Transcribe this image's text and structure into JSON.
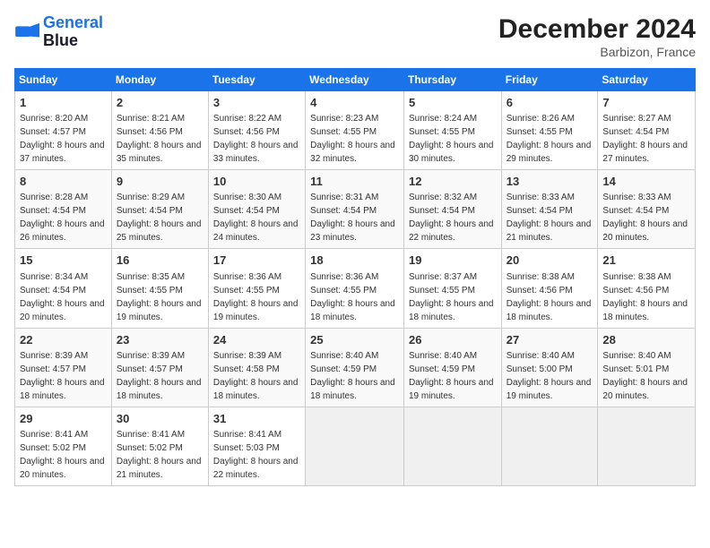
{
  "logo": {
    "line1": "General",
    "line2": "Blue"
  },
  "title": "December 2024",
  "location": "Barbizon, France",
  "days_of_week": [
    "Sunday",
    "Monday",
    "Tuesday",
    "Wednesday",
    "Thursday",
    "Friday",
    "Saturday"
  ],
  "weeks": [
    [
      {
        "day": 1,
        "sunrise": "8:20 AM",
        "sunset": "4:57 PM",
        "daylight": "8 hours and 37 minutes."
      },
      {
        "day": 2,
        "sunrise": "8:21 AM",
        "sunset": "4:56 PM",
        "daylight": "8 hours and 35 minutes."
      },
      {
        "day": 3,
        "sunrise": "8:22 AM",
        "sunset": "4:56 PM",
        "daylight": "8 hours and 33 minutes."
      },
      {
        "day": 4,
        "sunrise": "8:23 AM",
        "sunset": "4:55 PM",
        "daylight": "8 hours and 32 minutes."
      },
      {
        "day": 5,
        "sunrise": "8:24 AM",
        "sunset": "4:55 PM",
        "daylight": "8 hours and 30 minutes."
      },
      {
        "day": 6,
        "sunrise": "8:26 AM",
        "sunset": "4:55 PM",
        "daylight": "8 hours and 29 minutes."
      },
      {
        "day": 7,
        "sunrise": "8:27 AM",
        "sunset": "4:54 PM",
        "daylight": "8 hours and 27 minutes."
      }
    ],
    [
      {
        "day": 8,
        "sunrise": "8:28 AM",
        "sunset": "4:54 PM",
        "daylight": "8 hours and 26 minutes."
      },
      {
        "day": 9,
        "sunrise": "8:29 AM",
        "sunset": "4:54 PM",
        "daylight": "8 hours and 25 minutes."
      },
      {
        "day": 10,
        "sunrise": "8:30 AM",
        "sunset": "4:54 PM",
        "daylight": "8 hours and 24 minutes."
      },
      {
        "day": 11,
        "sunrise": "8:31 AM",
        "sunset": "4:54 PM",
        "daylight": "8 hours and 23 minutes."
      },
      {
        "day": 12,
        "sunrise": "8:32 AM",
        "sunset": "4:54 PM",
        "daylight": "8 hours and 22 minutes."
      },
      {
        "day": 13,
        "sunrise": "8:33 AM",
        "sunset": "4:54 PM",
        "daylight": "8 hours and 21 minutes."
      },
      {
        "day": 14,
        "sunrise": "8:33 AM",
        "sunset": "4:54 PM",
        "daylight": "8 hours and 20 minutes."
      }
    ],
    [
      {
        "day": 15,
        "sunrise": "8:34 AM",
        "sunset": "4:54 PM",
        "daylight": "8 hours and 20 minutes."
      },
      {
        "day": 16,
        "sunrise": "8:35 AM",
        "sunset": "4:55 PM",
        "daylight": "8 hours and 19 minutes."
      },
      {
        "day": 17,
        "sunrise": "8:36 AM",
        "sunset": "4:55 PM",
        "daylight": "8 hours and 19 minutes."
      },
      {
        "day": 18,
        "sunrise": "8:36 AM",
        "sunset": "4:55 PM",
        "daylight": "8 hours and 18 minutes."
      },
      {
        "day": 19,
        "sunrise": "8:37 AM",
        "sunset": "4:55 PM",
        "daylight": "8 hours and 18 minutes."
      },
      {
        "day": 20,
        "sunrise": "8:38 AM",
        "sunset": "4:56 PM",
        "daylight": "8 hours and 18 minutes."
      },
      {
        "day": 21,
        "sunrise": "8:38 AM",
        "sunset": "4:56 PM",
        "daylight": "8 hours and 18 minutes."
      }
    ],
    [
      {
        "day": 22,
        "sunrise": "8:39 AM",
        "sunset": "4:57 PM",
        "daylight": "8 hours and 18 minutes."
      },
      {
        "day": 23,
        "sunrise": "8:39 AM",
        "sunset": "4:57 PM",
        "daylight": "8 hours and 18 minutes."
      },
      {
        "day": 24,
        "sunrise": "8:39 AM",
        "sunset": "4:58 PM",
        "daylight": "8 hours and 18 minutes."
      },
      {
        "day": 25,
        "sunrise": "8:40 AM",
        "sunset": "4:59 PM",
        "daylight": "8 hours and 18 minutes."
      },
      {
        "day": 26,
        "sunrise": "8:40 AM",
        "sunset": "4:59 PM",
        "daylight": "8 hours and 19 minutes."
      },
      {
        "day": 27,
        "sunrise": "8:40 AM",
        "sunset": "5:00 PM",
        "daylight": "8 hours and 19 minutes."
      },
      {
        "day": 28,
        "sunrise": "8:40 AM",
        "sunset": "5:01 PM",
        "daylight": "8 hours and 20 minutes."
      }
    ],
    [
      {
        "day": 29,
        "sunrise": "8:41 AM",
        "sunset": "5:02 PM",
        "daylight": "8 hours and 20 minutes."
      },
      {
        "day": 30,
        "sunrise": "8:41 AM",
        "sunset": "5:02 PM",
        "daylight": "8 hours and 21 minutes."
      },
      {
        "day": 31,
        "sunrise": "8:41 AM",
        "sunset": "5:03 PM",
        "daylight": "8 hours and 22 minutes."
      },
      null,
      null,
      null,
      null
    ]
  ]
}
